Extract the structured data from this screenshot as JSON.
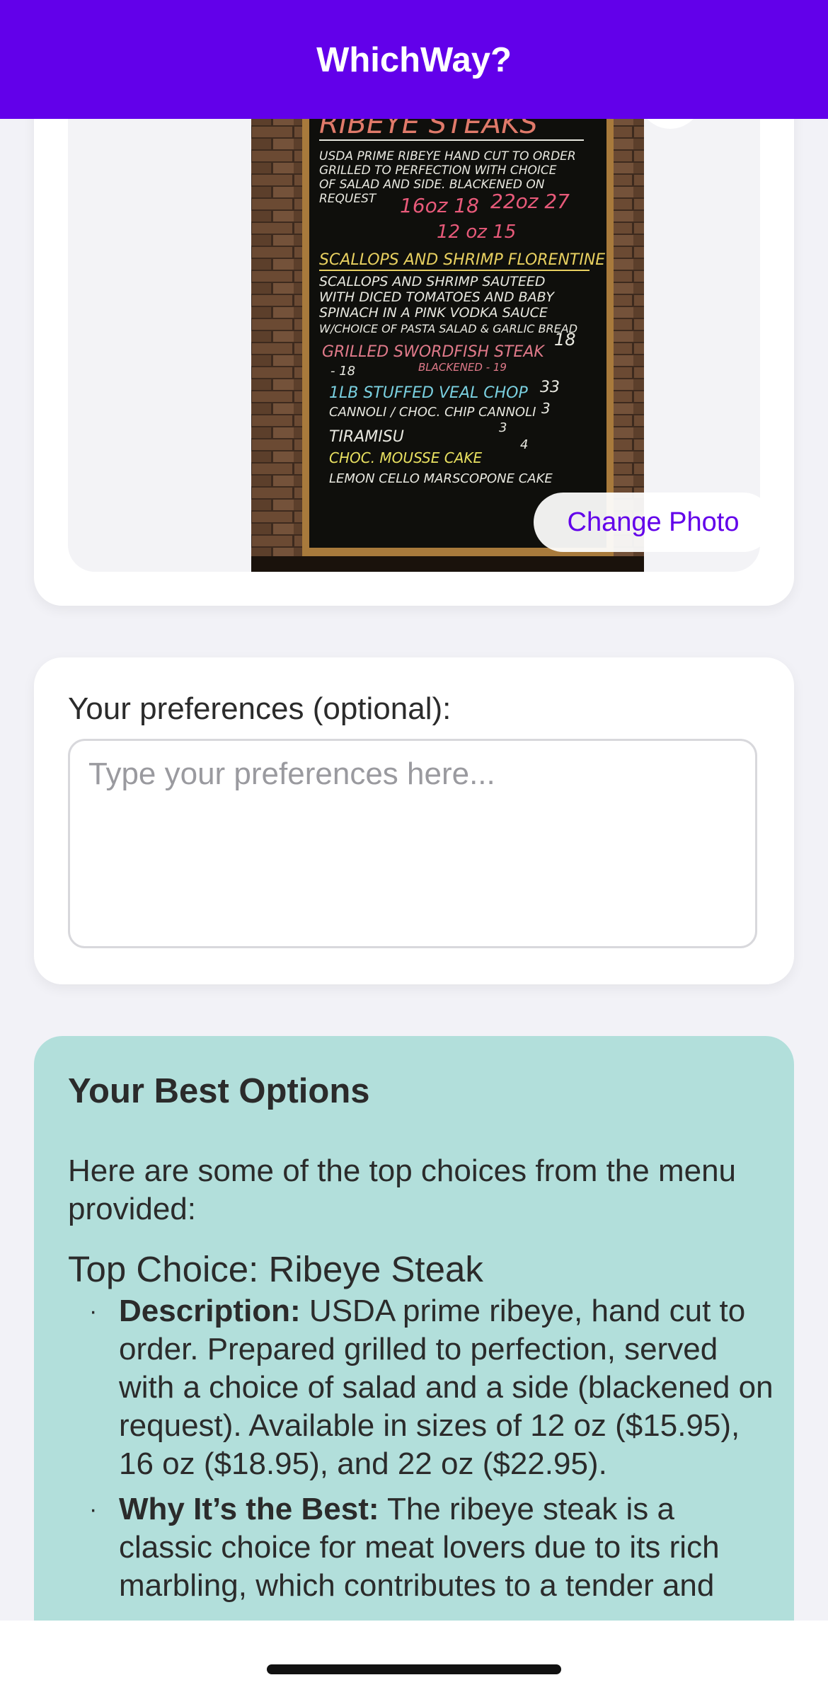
{
  "header": {
    "title": "WhichWay?"
  },
  "photo": {
    "change_label": "Change Photo"
  },
  "preferences": {
    "label": "Your preferences (optional):",
    "placeholder": "Type your preferences here...",
    "value": ""
  },
  "results": {
    "title": "Your Best Options",
    "intro": "Here are some of the top choices from the menu provided:",
    "top_choice": "Top Choice: Ribeye Steak",
    "bullets": [
      {
        "term": "Description:",
        "text": " USDA prime ribeye, hand cut to order. Prepared grilled to perfection, served with a choice of salad and a side (blackened on request). Available in sizes of 12 oz ($15.95), 16 oz ($18.95), and 22 oz ($22.95)."
      },
      {
        "term": "Why It’s the Best:",
        "text": " The ribeye steak is a classic choice for meat lovers due to its rich marbling, which contributes to a tender and"
      }
    ]
  },
  "colors": {
    "header_bg": "#6200ea",
    "accent": "#6200ea",
    "results_bg": "#b2dfdb",
    "page_bg": "#f2f2f7"
  }
}
